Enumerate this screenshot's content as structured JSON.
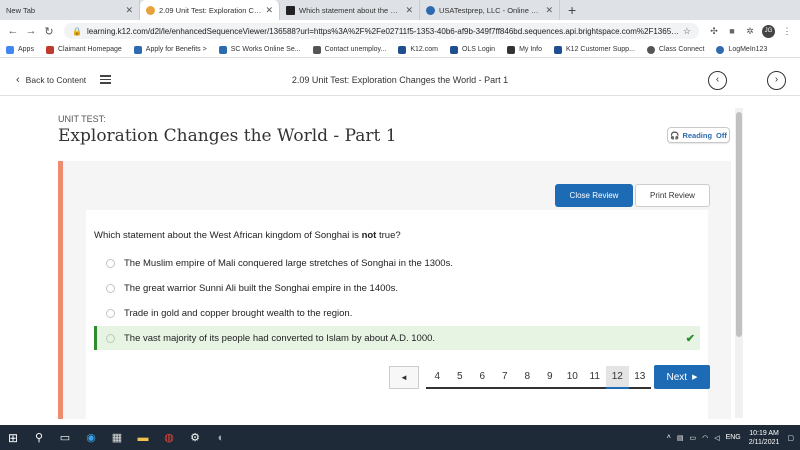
{
  "browser": {
    "tabs": [
      {
        "title": "New Tab",
        "icon_color": "#dee1e6"
      },
      {
        "title": "2.09 Unit Test: Exploration Changes",
        "icon_color": "#e9a23b"
      },
      {
        "title": "Which statement about the West",
        "icon_color": "#222222"
      },
      {
        "title": "USATestprep, LLC - Online State",
        "icon_color": "#2d6bb0"
      }
    ],
    "new_tab_label": "+",
    "url": "learning.k12.com/d2l/le/enhancedSequenceViewer/136588?url=https%3A%2F%2Fe02711f5-1353-40b6-af9b-349f7ff846bd.sequences.api.brightspace.com%2F136588...",
    "profile_initial": "JG"
  },
  "bookmarks": [
    {
      "label": "Apps",
      "color": "#4285f4"
    },
    {
      "label": "Claimant Homepage",
      "color": "#c0392b"
    },
    {
      "label": "Apply for Benefits >",
      "color": "#2d6bb0"
    },
    {
      "label": "SC Works Online Se...",
      "color": "#2d6bb0"
    },
    {
      "label": "Contact unemploy...",
      "color": "#555555"
    },
    {
      "label": "K12.com",
      "color": "#1d4f91"
    },
    {
      "label": "OLS Login",
      "color": "#1d4f91"
    },
    {
      "label": "My Info",
      "color": "#333333"
    },
    {
      "label": "K12 Customer Supp...",
      "color": "#1d4f91"
    },
    {
      "label": "Class Connect",
      "color": "#555555"
    },
    {
      "label": "LogMeIn123",
      "color": "#2d6bb0"
    }
  ],
  "toolbar": {
    "back_label": "Back to Content",
    "title": "2.09 Unit Test: Exploration Changes the World - Part 1"
  },
  "header": {
    "unit_label": "UNIT TEST:",
    "title": "Exploration Changes the World - Part 1",
    "reading_label": "Reading",
    "reading_state": "Off"
  },
  "review": {
    "close_label": "Close Review",
    "print_label": "Print Review"
  },
  "question": {
    "prefix": "Which statement about the West African kingdom of Songhai is ",
    "emphasis": "not",
    "suffix": " true?",
    "options": [
      "The Muslim empire of Mali conquered large stretches of Songhai in the 1300s.",
      "The great warrior Sunni Ali built the Songhai empire in the 1400s.",
      "Trade in gold and copper brought wealth to the region.",
      "The vast majority of its people had converted to Islam by about A.D. 1000."
    ],
    "correct_index": 3
  },
  "pager": {
    "prev_label": "◄",
    "pages": [
      "4",
      "5",
      "6",
      "7",
      "8",
      "9",
      "10",
      "11",
      "12",
      "13"
    ],
    "current": "12",
    "next_label": "Next"
  },
  "taskbar": {
    "language": "ENG",
    "time": "10:19 AM",
    "date": "2/11/2021"
  }
}
